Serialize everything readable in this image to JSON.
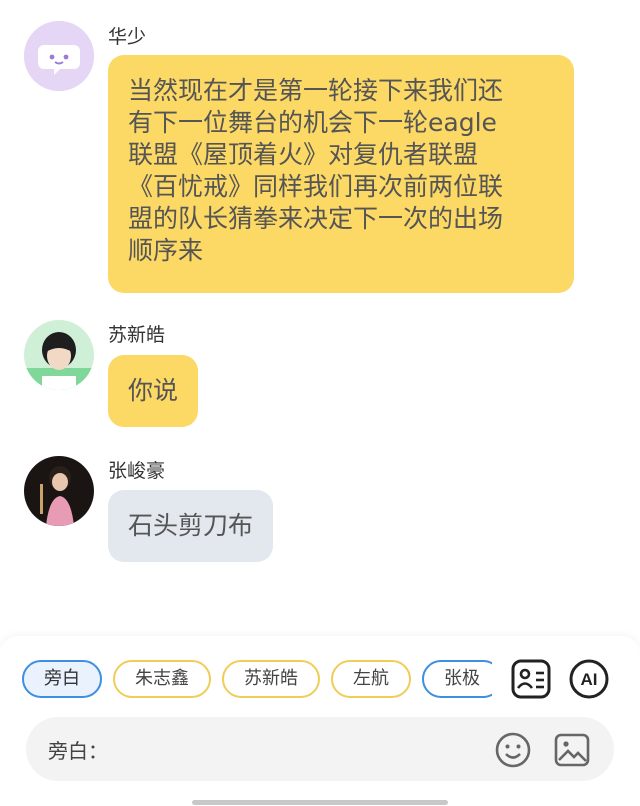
{
  "messages": [
    {
      "sender": "华少",
      "lines": [
        "当然现在才是第一轮接下来我们还",
        "有下一位舞台的机会下一轮eagle",
        "联盟《屋顶着火》对复仇者联盟",
        "《百忧戒》同样我们再次前两位联",
        "盟的队长猜拳来决定下一次的出场",
        "顺序来"
      ]
    },
    {
      "sender": "苏新皓",
      "text": "你说"
    },
    {
      "sender": "张峻豪",
      "text": "石头剪刀布"
    }
  ],
  "roles": [
    "旁白",
    "朱志鑫",
    "苏新皓",
    "左航",
    "张极"
  ],
  "tools": {
    "ai_label": "AI"
  },
  "input": {
    "label": "旁白："
  },
  "icons": [
    "chat-bubble-icon",
    "contact-card-icon",
    "ai-icon",
    "emoji-icon",
    "image-icon"
  ],
  "colors": {
    "bubble_yellow": "#FCD865",
    "bubble_gray": "#E3E8EF",
    "accent_blue": "#3D8FE0",
    "chip_yellow": "#F0CC58"
  }
}
